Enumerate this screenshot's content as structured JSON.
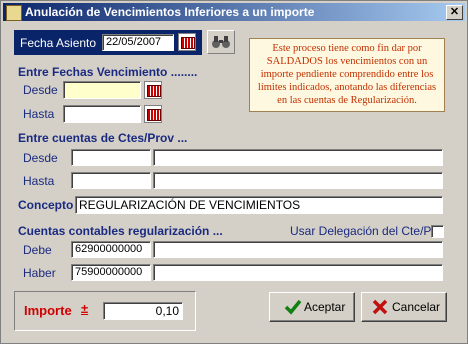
{
  "window": {
    "title": "Anulación de Vencimientos Inferiores a un importe",
    "close_label": "✕"
  },
  "fecha_asiento": {
    "label": "Fecha Asiento",
    "value": "22/05/2007"
  },
  "info_text": "Este proceso tiene como fin dar por SALDADOS los vencimientos con un importe pendiente comprendido entre los límites indicados, anotando las diferencias en las cuentas de Regularización.",
  "fechas": {
    "title": "Entre Fechas Vencimiento ........",
    "desde_label": "Desde",
    "hasta_label": "Hasta",
    "desde_value": "",
    "hasta_value": ""
  },
  "cuentas": {
    "title": "Entre cuentas de Ctes/Prov ...",
    "desde_label": "Desde",
    "hasta_label": "Hasta",
    "desde_code": "",
    "desde_name": "",
    "hasta_code": "",
    "hasta_name": ""
  },
  "concepto": {
    "label": "Concepto",
    "value": "REGULARIZACIÓN DE VENCIMIENTOS"
  },
  "regularizacion": {
    "title": "Cuentas contables regularización ...",
    "usar_delegacion": "Usar Delegación del Cte/Pro",
    "debe_label": "Debe",
    "debe_code": "62900000000",
    "debe_name": "",
    "haber_label": "Haber",
    "haber_code": "75900000000",
    "haber_name": ""
  },
  "importe": {
    "label": "Importe",
    "sign": "±",
    "value": "0,10"
  },
  "buttons": {
    "aceptar": "Aceptar",
    "cancelar": "Cancelar"
  },
  "icons": {
    "calendar": "calendar-icon",
    "binoculars": "binoculars-icon",
    "check": "check-icon",
    "cancel": "cancel-icon"
  }
}
